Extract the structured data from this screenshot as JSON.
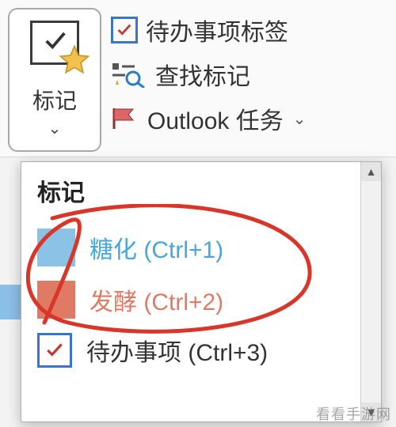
{
  "ribbon": {
    "tag_button_label": "标记",
    "side_items": {
      "todo": "待办事项标签",
      "find": "查找标记",
      "outlook": "Outlook 任务"
    }
  },
  "dropdown": {
    "title": "标记",
    "items": [
      {
        "label": "糖化 (Ctrl+1)",
        "swatch": "blue"
      },
      {
        "label": "发酵 (Ctrl+2)",
        "swatch": "red"
      },
      {
        "label": "待办事项 (Ctrl+3)",
        "swatch": "check"
      }
    ]
  },
  "colors": {
    "blue_swatch": "#8ac3e6",
    "red_swatch": "#e07a64",
    "accent_blue": "#3a76c4",
    "annotation_red": "#d9362a"
  },
  "watermark": "看看手游网"
}
